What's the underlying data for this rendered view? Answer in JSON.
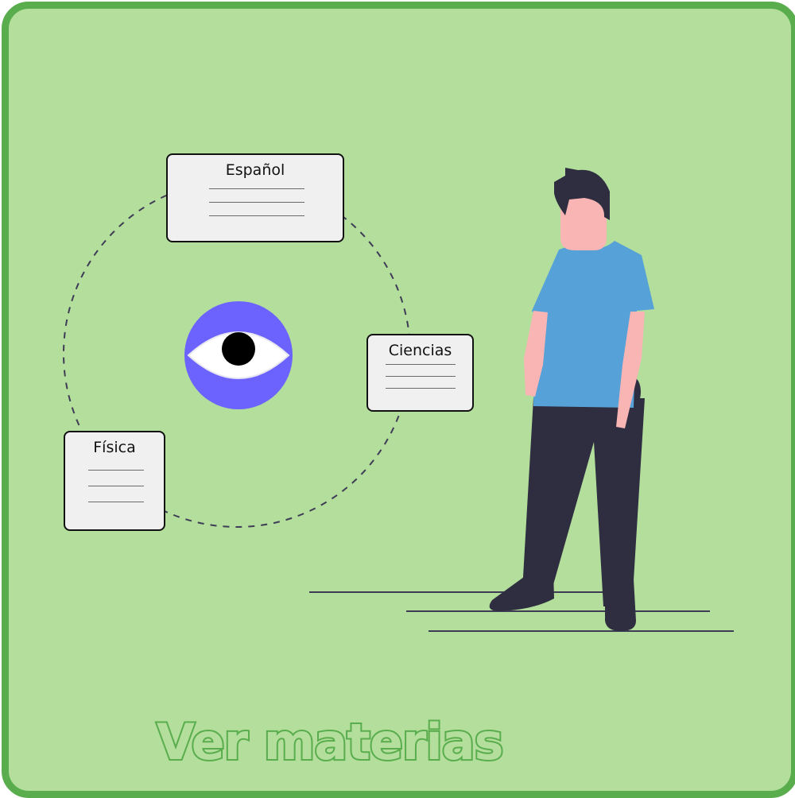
{
  "title": "Ver materias",
  "subjects": [
    {
      "name": "Español"
    },
    {
      "name": "Ciencias"
    },
    {
      "name": "Física"
    }
  ],
  "icons": {
    "center": "eye-icon",
    "illustration": "standing-person-illustration"
  },
  "colors": {
    "background": "#b3de9c",
    "border": "#59ad4d",
    "title": "#59ad4d",
    "eye_circle": "#6c63ff",
    "card_fill": "#f0f0f0",
    "shirt": "#56a2d8",
    "pants": "#2f2e41",
    "skin": "#f9b4b4"
  }
}
